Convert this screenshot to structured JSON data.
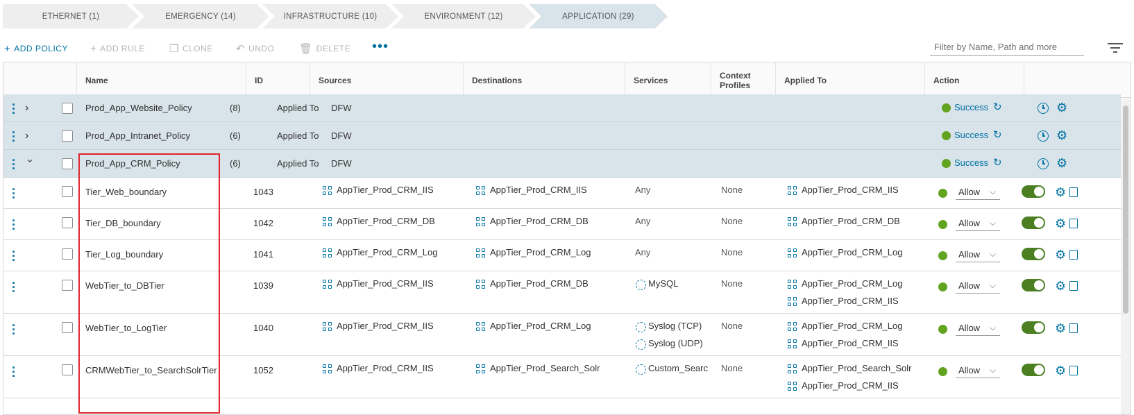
{
  "tabs": [
    {
      "label": "ETHERNET (1)",
      "active": false
    },
    {
      "label": "EMERGENCY (14)",
      "active": false
    },
    {
      "label": "INFRASTRUCTURE (10)",
      "active": false
    },
    {
      "label": "ENVIRONMENT (12)",
      "active": false
    },
    {
      "label": "APPLICATION (29)",
      "active": true
    }
  ],
  "toolbar": {
    "add_policy": "ADD POLICY",
    "add_rule": "ADD RULE",
    "clone": "CLONE",
    "undo": "UNDO",
    "delete": "DELETE",
    "more": "•••"
  },
  "filter": {
    "placeholder": "Filter by Name, Path and more"
  },
  "columns": {
    "name": "Name",
    "id": "ID",
    "sources": "Sources",
    "destinations": "Destinations",
    "services": "Services",
    "context_profiles": "Context Profiles",
    "applied_to": "Applied To",
    "action": "Action"
  },
  "policies": [
    {
      "name": "Prod_App_Website_Policy",
      "count": "(8)",
      "applied_label": "Applied To",
      "applied_value": "DFW",
      "status": "Success",
      "expanded": false
    },
    {
      "name": "Prod_App_Intranet_Policy",
      "count": "(6)",
      "applied_label": "Applied To",
      "applied_value": "DFW",
      "status": "Success",
      "expanded": false
    },
    {
      "name": "Prod_App_CRM_Policy",
      "count": "(6)",
      "applied_label": "Applied To",
      "applied_value": "DFW",
      "status": "Success",
      "expanded": true
    }
  ],
  "rules": [
    {
      "name": "Tier_Web_boundary",
      "id": "1043",
      "sources": [
        "AppTier_Prod_CRM_IIS"
      ],
      "destinations": [
        "AppTier_Prod_CRM_IIS"
      ],
      "services": [
        "Any"
      ],
      "services_icon": false,
      "context": "None",
      "applied_to": [
        "AppTier_Prod_CRM_IIS"
      ],
      "action": "Allow"
    },
    {
      "name": "Tier_DB_boundary",
      "id": "1042",
      "sources": [
        "AppTier_Prod_CRM_DB"
      ],
      "destinations": [
        "AppTier_Prod_CRM_DB"
      ],
      "services": [
        "Any"
      ],
      "services_icon": false,
      "context": "None",
      "applied_to": [
        "AppTier_Prod_CRM_DB"
      ],
      "action": "Allow"
    },
    {
      "name": "Tier_Log_boundary",
      "id": "1041",
      "sources": [
        "AppTier_Prod_CRM_Log"
      ],
      "destinations": [
        "AppTier_Prod_CRM_Log"
      ],
      "services": [
        "Any"
      ],
      "services_icon": false,
      "context": "None",
      "applied_to": [
        "AppTier_Prod_CRM_Log"
      ],
      "action": "Allow"
    },
    {
      "name": "WebTier_to_DBTier",
      "id": "1039",
      "sources": [
        "AppTier_Prod_CRM_IIS"
      ],
      "destinations": [
        "AppTier_Prod_CRM_DB"
      ],
      "services": [
        "MySQL"
      ],
      "services_icon": true,
      "context": "None",
      "applied_to": [
        "AppTier_Prod_CRM_Log",
        "AppTier_Prod_CRM_IIS"
      ],
      "action": "Allow"
    },
    {
      "name": "WebTier_to_LogTier",
      "id": "1040",
      "sources": [
        "AppTier_Prod_CRM_IIS"
      ],
      "destinations": [
        "AppTier_Prod_CRM_Log"
      ],
      "services": [
        "Syslog (TCP)",
        "Syslog (UDP)"
      ],
      "services_icon": true,
      "context": "None",
      "applied_to": [
        "AppTier_Prod_CRM_Log",
        "AppTier_Prod_CRM_IIS"
      ],
      "action": "Allow"
    },
    {
      "name": "CRMWebTier_to_SearchSolrTier",
      "id": "1052",
      "sources": [
        "AppTier_Prod_CRM_IIS"
      ],
      "destinations": [
        "AppTier_Prod_Search_Solr"
      ],
      "services": [
        "Custom_Searc"
      ],
      "services_icon": true,
      "context": "None",
      "applied_to": [
        "AppTier_Prod_Search_Solr",
        "AppTier_Prod_CRM_IIS"
      ],
      "action": "Allow"
    }
  ],
  "colors": {
    "accent": "#0072a3",
    "policy_row_bg": "#d8e3ea",
    "success_green": "#62a420",
    "toggle_green": "#4b7f22",
    "highlight_red": "#e0252c"
  }
}
